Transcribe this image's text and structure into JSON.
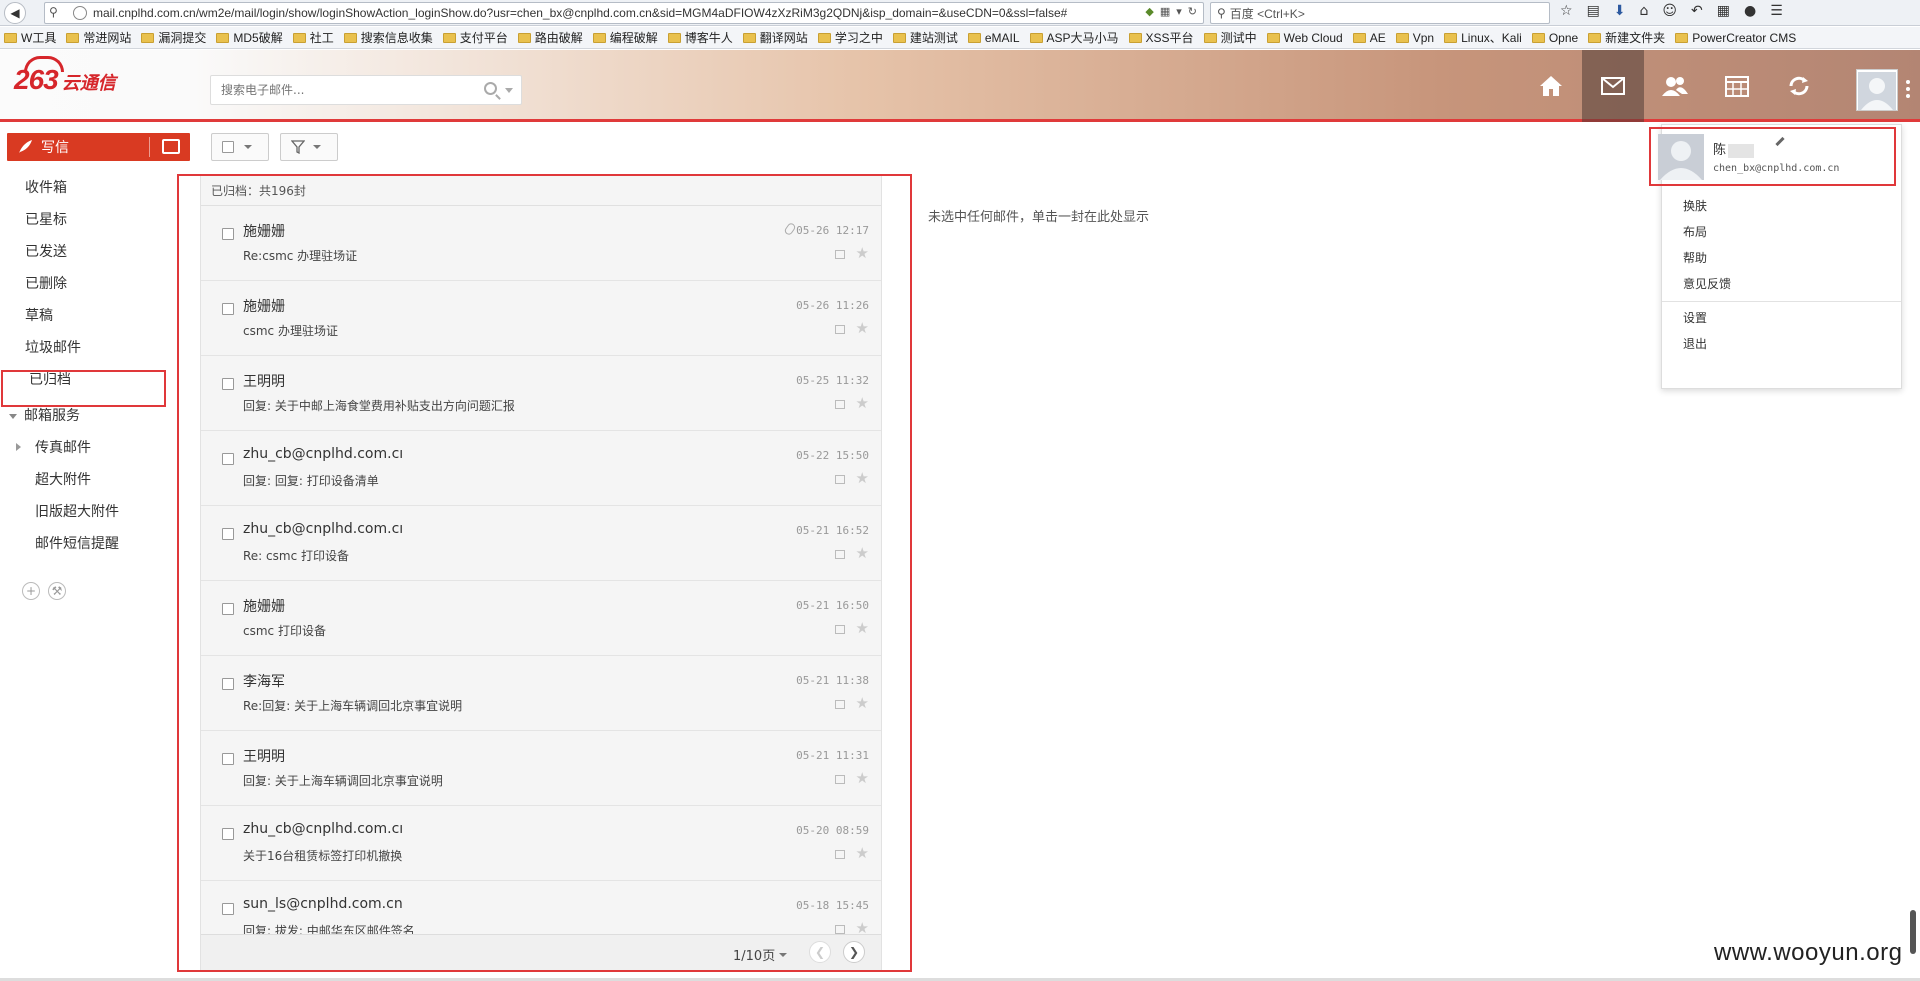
{
  "browser": {
    "url": "mail.cnplhd.com.cn/wm2e/mail/login/show/loginShowAction_loginShow.do?usr=chen_bx@cnplhd.com.cn&sid=MGM4aDFIOW4zXzRiM3g2QDNj&isp_domain=&useCDN=0&ssl=false#",
    "search_placeholder": "百度 <Ctrl+K>",
    "bookmarks": [
      "W工具",
      "常进网站",
      "漏洞提交",
      "MD5破解",
      "社工",
      "搜索信息收集",
      "支付平台",
      "路由破解",
      "编程破解",
      "博客牛人",
      "翻译网站",
      "学习之中",
      "建站测试",
      "eMAIL",
      "ASP大马小马",
      "XSS平台",
      "测试中",
      "Web Cloud",
      "AE",
      "Vpn",
      "Linux、Kali",
      "Opne",
      "新建文件夹",
      "PowerCreator CMS"
    ]
  },
  "header": {
    "logo_num": "263",
    "logo_text": "云通信",
    "search_placeholder": "搜索电子邮件..."
  },
  "toolbar": {
    "compose_label": "写信"
  },
  "sidebar": {
    "folders": [
      "收件箱",
      "已星标",
      "已发送",
      "已删除",
      "草稿",
      "垃圾邮件"
    ],
    "active_folder": "已归档",
    "section": "邮箱服务",
    "services": [
      "传真邮件",
      "超大附件",
      "旧版超大附件",
      "邮件短信提醒"
    ]
  },
  "mail_list": {
    "header": "已归档：共196封",
    "items": [
      {
        "sender": "施姗姗",
        "subject": "Re:csmc 办理驻场证",
        "time": "05-26 12:17",
        "attachment": true
      },
      {
        "sender": "施姗姗",
        "subject": "csmc 办理驻场证",
        "time": "05-26 11:26",
        "attachment": false
      },
      {
        "sender": "王明明",
        "subject": "回复: 关于中邮上海食堂费用补贴支出方向问题汇报",
        "time": "05-25 11:32",
        "attachment": false
      },
      {
        "sender": "zhu_cb@cnplhd.com.cı",
        "subject": "回复: 回复: 打印设备清单",
        "time": "05-22 15:50",
        "attachment": false
      },
      {
        "sender": "zhu_cb@cnplhd.com.cı",
        "subject": "Re: csmc 打印设备",
        "time": "05-21 16:52",
        "attachment": false
      },
      {
        "sender": "施姗姗",
        "subject": "csmc 打印设备",
        "time": "05-21 16:50",
        "attachment": false
      },
      {
        "sender": "李海军",
        "subject": "Re:回复: 关于上海车辆调回北京事宜说明",
        "time": "05-21 11:38",
        "attachment": false
      },
      {
        "sender": "王明明",
        "subject": "回复: 关于上海车辆调回北京事宜说明",
        "time": "05-21 11:31",
        "attachment": false
      },
      {
        "sender": "zhu_cb@cnplhd.com.cı",
        "subject": "关于16台租赁标签打印机撤换",
        "time": "05-20 08:59",
        "attachment": false
      },
      {
        "sender": "sun_ls@cnplhd.com.cn",
        "subject": "回复: 拔发: 中邮华东区邮件签名",
        "time": "05-18 15:45",
        "attachment": false
      }
    ],
    "pager": "1/10页"
  },
  "reading_pane": {
    "empty_text": "未选中任何邮件，单击一封在此处显示"
  },
  "user_menu": {
    "name": "陈",
    "email": "chen_bx@cnplhd.com.cn",
    "items_top": [
      "换肤",
      "布局",
      "帮助",
      "意见反馈"
    ],
    "items_bottom": [
      "设置",
      "退出"
    ]
  },
  "watermark": "www.wooyun.org",
  "colors": {
    "accent_red": "#e0383a",
    "compose_red": "#d93a22",
    "brand_red": "#d6262b"
  }
}
